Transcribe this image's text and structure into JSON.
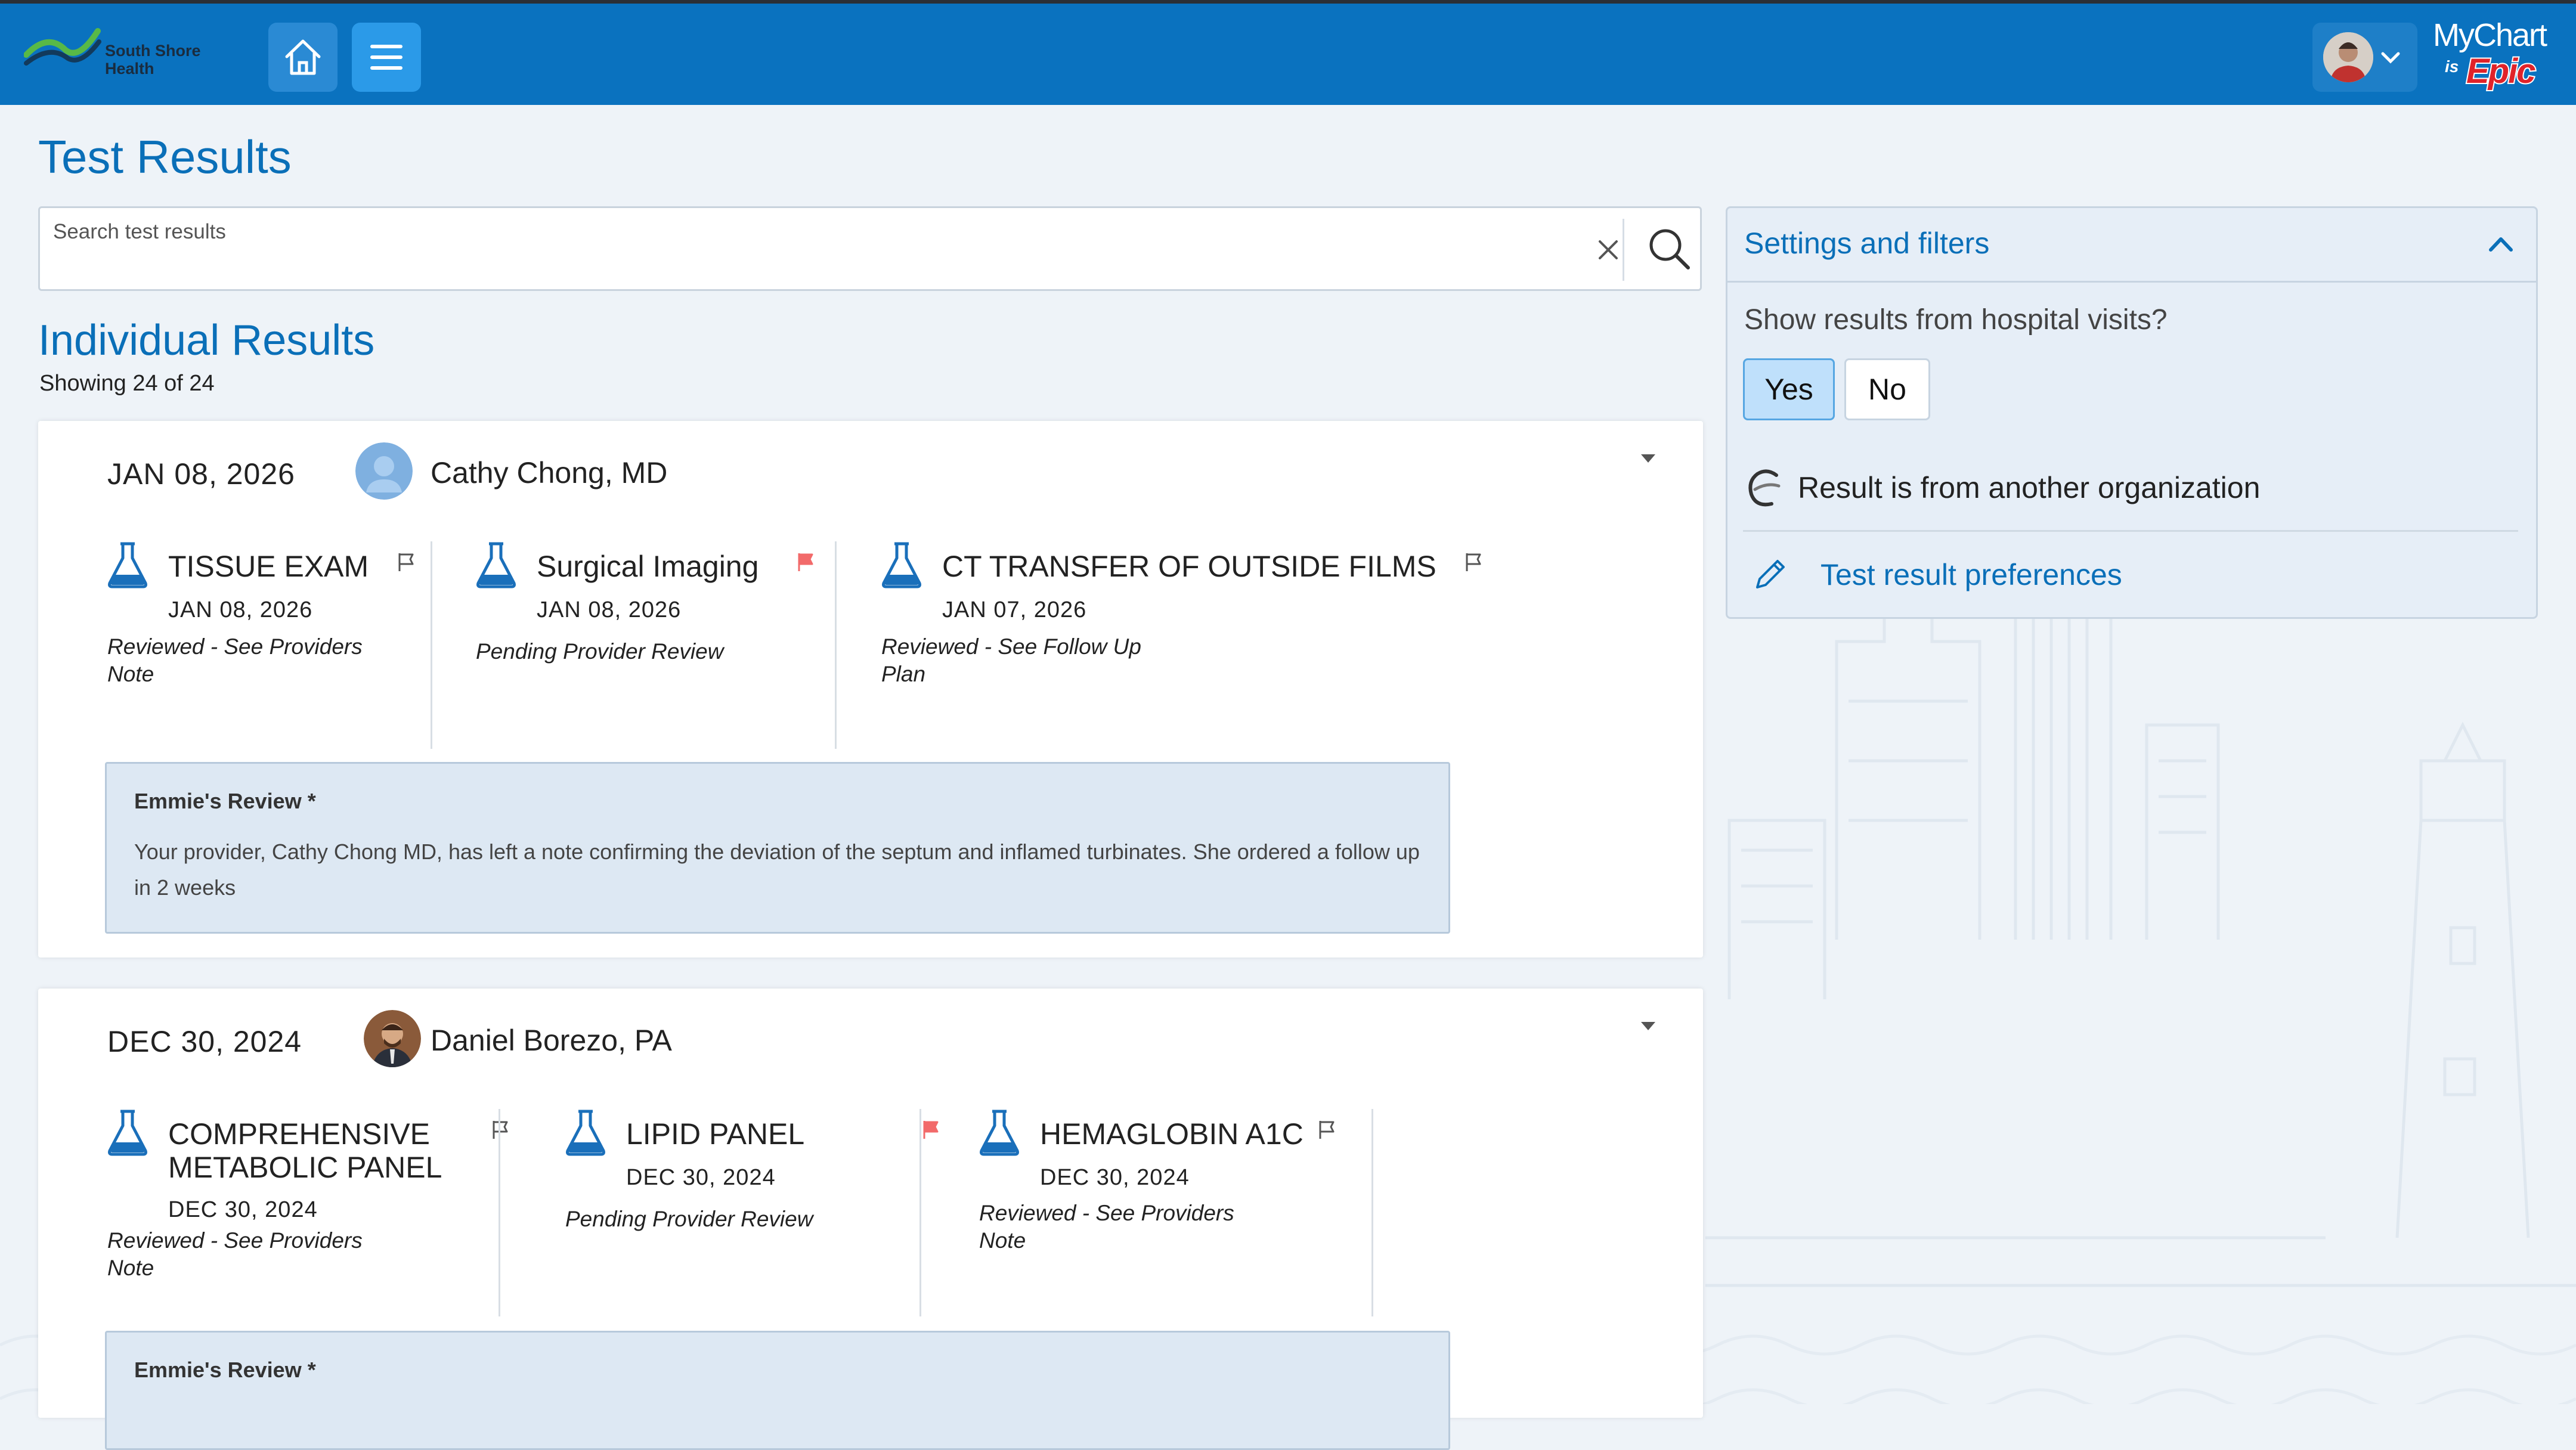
{
  "header": {
    "org_name_line1": "South Shore",
    "org_name_line2": "Health",
    "home_icon": "home-icon",
    "menu_icon": "hamburger-menu-icon",
    "brand_mychart": "MyChart",
    "brand_is": "is",
    "brand_epic": "Epic",
    "brand_color": "#0a72bf"
  },
  "page": {
    "title": "Test Results",
    "search_placeholder": "Search test results",
    "section_title": "Individual Results",
    "showing": "Showing 24 of 24"
  },
  "cards": [
    {
      "date": "JAN 08, 2026",
      "provider": "Cathy Chong, MD",
      "results": [
        {
          "name": "TISSUE EXAM",
          "date": "JAN 08, 2026",
          "status": "Reviewed - See Providers Note",
          "flagged": false
        },
        {
          "name": "Surgical Imaging",
          "date": "JAN 08, 2026",
          "status": "Pending Provider Review",
          "flagged": true
        },
        {
          "name": "CT TRANSFER OF OUTSIDE FILMS",
          "date": "JAN 07, 2026",
          "status": "Reviewed - See Follow Up Plan",
          "flagged": false
        }
      ],
      "review_title": "Emmie's Review *",
      "review_body": "Your provider, Cathy Chong MD, has left a note confirming the deviation of the septum and inflamed turbinates. She ordered a follow up in 2 weeks"
    },
    {
      "date": "DEC 30, 2024",
      "provider": "Daniel Borezo, PA",
      "results": [
        {
          "name_line1": "COMPREHENSIVE",
          "name_line2": "METABOLIC PANEL",
          "date": "DEC 30, 2024",
          "status": "Reviewed - See Providers Note",
          "flagged": false
        },
        {
          "name": "LIPID PANEL",
          "date": "DEC 30, 2024",
          "status": "Pending Provider Review",
          "flagged": true
        },
        {
          "name": "HEMAGLOBIN A1C",
          "date": "DEC 30, 2024",
          "status": "Reviewed - See Providers Note",
          "flagged": false
        }
      ],
      "review_title": "Emmie's Review *"
    }
  ],
  "settings": {
    "title": "Settings and filters",
    "question": "Show results from hospital visits?",
    "yes_label": "Yes",
    "no_label": "No",
    "selected": "Yes",
    "other_org_text": "Result is from another organization",
    "prefs_link": "Test result preferences"
  },
  "colors": {
    "accent_blue": "#0a6fb8",
    "flag_red": "#f26a6a",
    "review_bg": "#dde8f3"
  }
}
